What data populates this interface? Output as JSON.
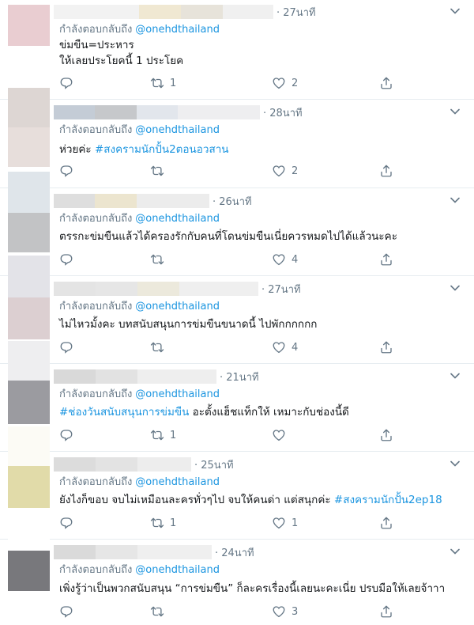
{
  "replying_label": "กำลังตอบกลับถึง",
  "mention": "@onehdthailand",
  "colors": {
    "link": "#1b95e0",
    "muted": "#657786",
    "text": "#14171a"
  },
  "tweets": [
    {
      "time": "27นาที",
      "lines": [
        "ข่มขืน=ประหาร",
        "ให้เลยประโยคนี้ 1 ประโยค"
      ],
      "reply_count": "",
      "retweet_count": "1",
      "like_count": "2"
    },
    {
      "time": "28นาที",
      "line_pre": "ห่วยค่ะ ",
      "hashtag": "#สงครามนักปั้น2ตอนอวสาน",
      "reply_count": "",
      "retweet_count": "",
      "like_count": "2"
    },
    {
      "time": "26นาที",
      "lines": [
        "ตรรกะข่มขืนแล้วได้ครองรักกับคนที่โดนข่มขืนเนี่ยควรหมดไปได้แล้วนะคะ"
      ],
      "reply_count": "",
      "retweet_count": "",
      "like_count": "4"
    },
    {
      "time": "27นาที",
      "lines": [
        "ไม่ไหวมั้งคะ บทสนับสนุนการข่มขืนขนาดนี้ ไปพักกกกกก"
      ],
      "reply_count": "",
      "retweet_count": "",
      "like_count": "4"
    },
    {
      "time": "21นาที",
      "hashtag": "#ช่องวันสนับสนุนการข่มขืน",
      "line_post": " อะตั้งแฮ็ชแท็กให้ เหมาะกับช่องนี้ดี",
      "reply_count": "",
      "retweet_count": "1",
      "like_count": ""
    },
    {
      "time": "25นาที",
      "line_pre": "ยังไงก็ขอบ จบไม่เหมือนละครทั่วๆไป จบให้คนด่า แต่สนุกค่ะ ",
      "hashtag": "#สงครามนักปั้น2ep18",
      "reply_count": "",
      "retweet_count": "1",
      "like_count": "1"
    },
    {
      "time": "24นาที",
      "lines": [
        "เพิ่งรู้ว่าเป็นพวกสนับสนุน “การข่มขืน” ก็ละครเรื่องนี้เลยนะคะเนี่ย ปรบมือให้เลยจ้าาา"
      ],
      "reply_count": "",
      "retweet_count": "",
      "like_count": "3"
    }
  ]
}
